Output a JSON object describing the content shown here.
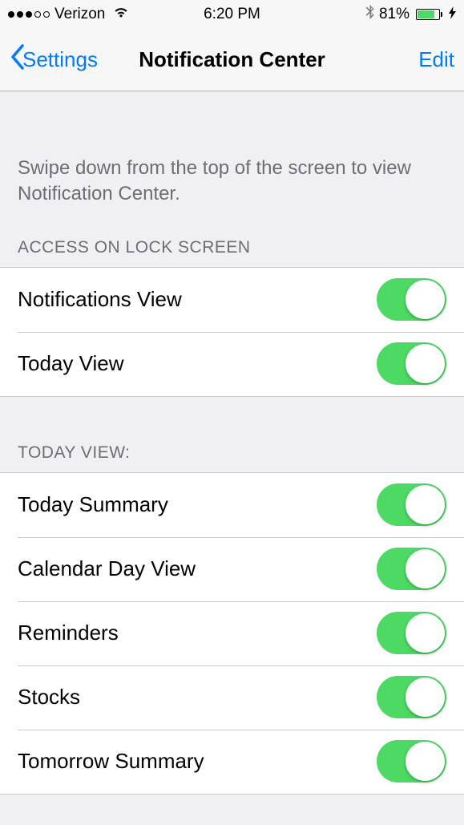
{
  "status": {
    "carrier": "Verizon",
    "time": "6:20 PM",
    "battery_pct": "81%",
    "battery_fill_pct": 81
  },
  "nav": {
    "back_label": "Settings",
    "title": "Notification Center",
    "edit_label": "Edit"
  },
  "description": "Swipe down from the top of the screen to view Notification Center.",
  "sections": {
    "lock": {
      "header": "ACCESS ON LOCK SCREEN",
      "items": [
        {
          "label": "Notifications View",
          "on": true
        },
        {
          "label": "Today View",
          "on": true
        }
      ]
    },
    "today": {
      "header": "TODAY VIEW:",
      "items": [
        {
          "label": "Today Summary",
          "on": true
        },
        {
          "label": "Calendar Day View",
          "on": true
        },
        {
          "label": "Reminders",
          "on": true
        },
        {
          "label": "Stocks",
          "on": true
        },
        {
          "label": "Tomorrow Summary",
          "on": true
        }
      ]
    }
  }
}
